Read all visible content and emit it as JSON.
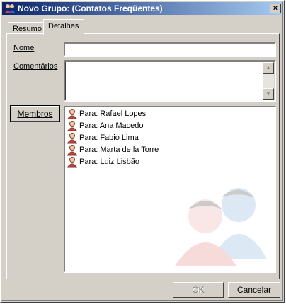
{
  "window": {
    "title": "Novo Grupo:  (Contatos Freqüentes)",
    "close_label": "×"
  },
  "tabs": [
    {
      "label": "Resumo"
    },
    {
      "label": "Detalhes"
    }
  ],
  "form": {
    "nome_label": "Nome",
    "nome_value": "",
    "comentarios_label": "Comentários",
    "comentarios_value": ""
  },
  "membros_label": "Membros",
  "members": [
    {
      "label": "Para:  Rafael Lopes"
    },
    {
      "label": "Para:  Ana Macedo"
    },
    {
      "label": "Para:  Fabio Lima"
    },
    {
      "label": "Para:  Marta de la Torre"
    },
    {
      "label": "Para:  Luiz Lisbão"
    }
  ],
  "buttons": {
    "ok_label": "OK",
    "cancel_label": "Cancelar"
  },
  "icons": {
    "title": "group-icon",
    "member": "contact-icon",
    "watermark": "group-watermark-icon"
  }
}
